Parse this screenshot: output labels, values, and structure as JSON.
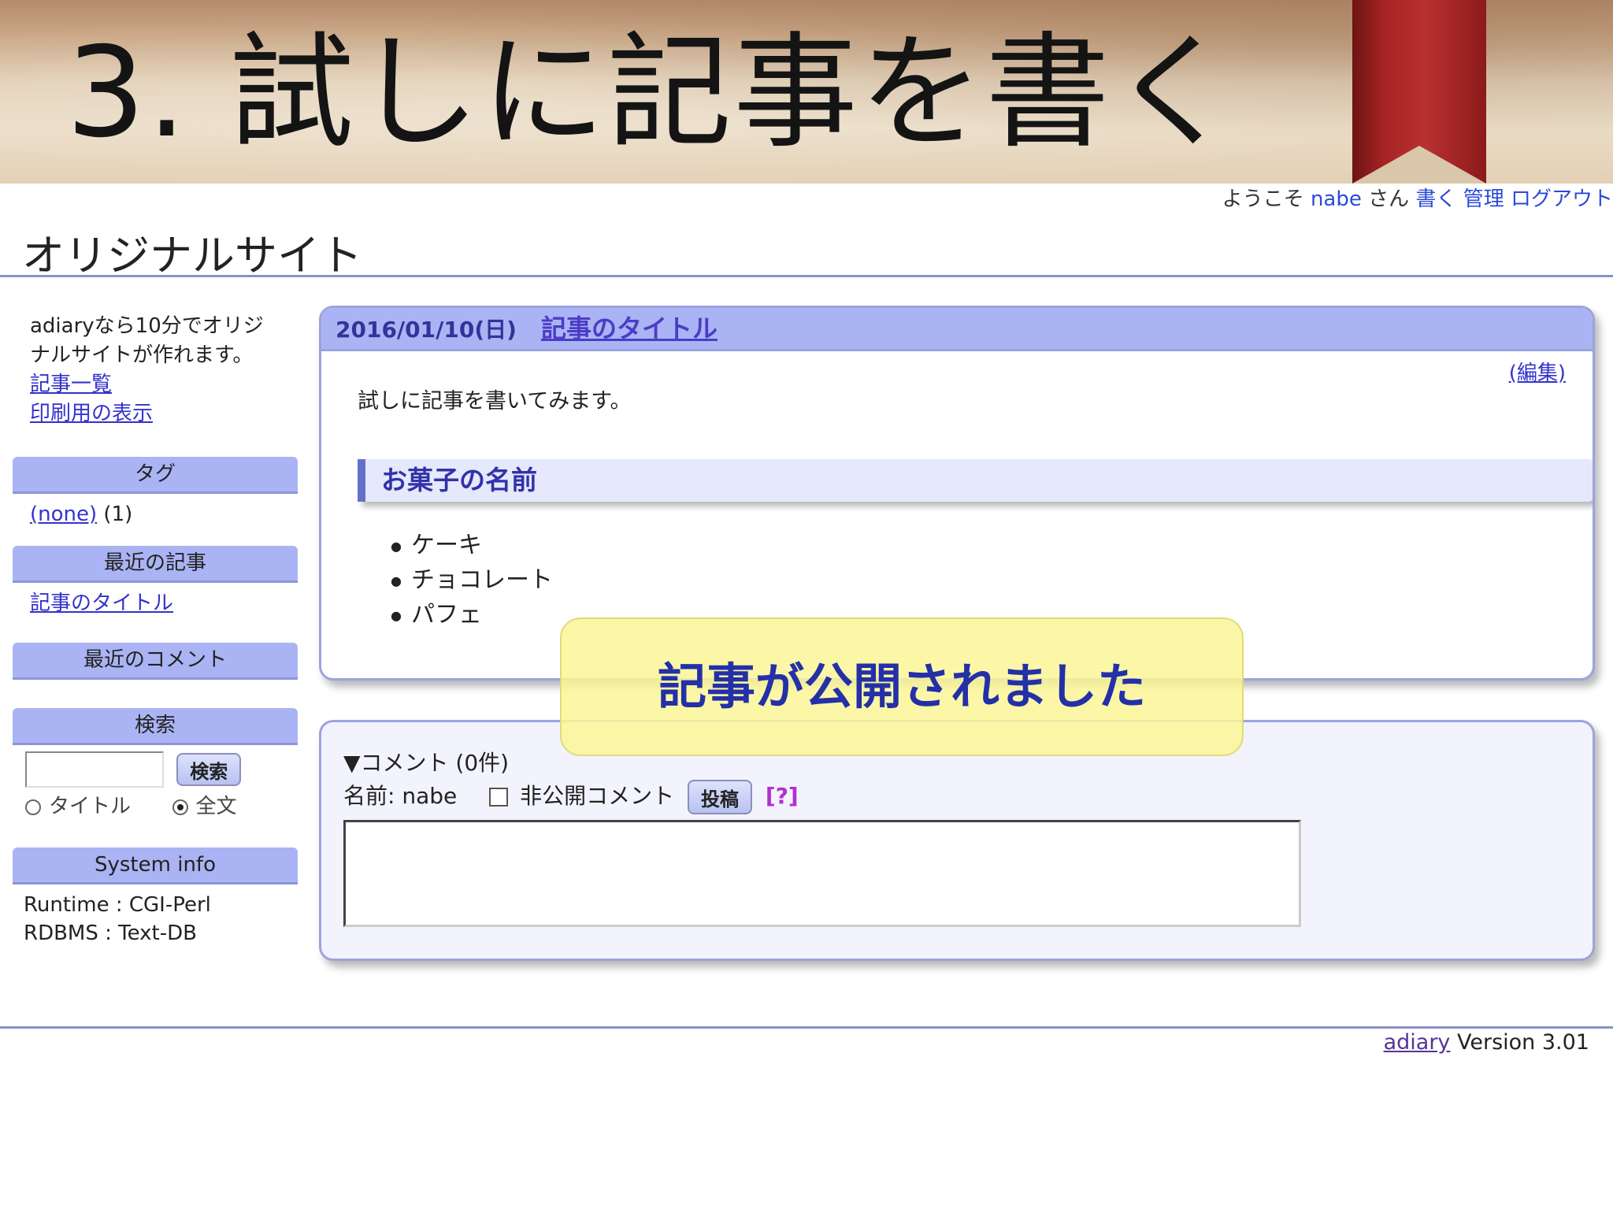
{
  "slide": {
    "title": "3. 試しに記事を書く"
  },
  "header": {
    "welcome_prefix": "ようこそ",
    "user": "nabe",
    "welcome_suffix": "さん",
    "links": {
      "write": "書く",
      "admin": "管理",
      "logout": "ログアウト"
    },
    "site_title": "オリジナルサイト"
  },
  "sidebar": {
    "intro": "adiaryなら10分でオリジナルサイトが作れます。",
    "links": {
      "article_list": "記事一覧",
      "print_view": "印刷用の表示"
    },
    "tags": {
      "heading": "タグ",
      "link": "(none)",
      "count": "(1)"
    },
    "recent_articles": {
      "heading": "最近の記事",
      "item": "記事のタイトル"
    },
    "recent_comments": {
      "heading": "最近のコメント"
    },
    "search": {
      "heading": "検索",
      "value": "",
      "button": "検索",
      "option_title": "タイトル",
      "option_full": "全文"
    },
    "system_info": {
      "heading": "System info",
      "runtime": "Runtime : CGI-Perl",
      "rdbms": "RDBMS : Text-DB"
    }
  },
  "article": {
    "date": "2016/01/10(日)",
    "title": "記事のタイトル",
    "edit": "(編集)",
    "body": "試しに記事を書いてみます。",
    "section": "お菓子の名前",
    "items": [
      "ケーキ",
      "チョコレート",
      "パフェ"
    ]
  },
  "comments": {
    "heading": "▼コメント (0件)",
    "name_label": "名前: nabe",
    "private_label": "非公開コメント",
    "post_button": "投稿",
    "help": "[?]",
    "text_value": ""
  },
  "toast": {
    "message": "記事が公開されました"
  },
  "footer": {
    "link": "adiary",
    "version": "Version 3.01"
  },
  "colors": {
    "accent": "#aab4f4",
    "border": "#9ca3e0",
    "link": "#3333cc",
    "toast": "#faf696"
  }
}
